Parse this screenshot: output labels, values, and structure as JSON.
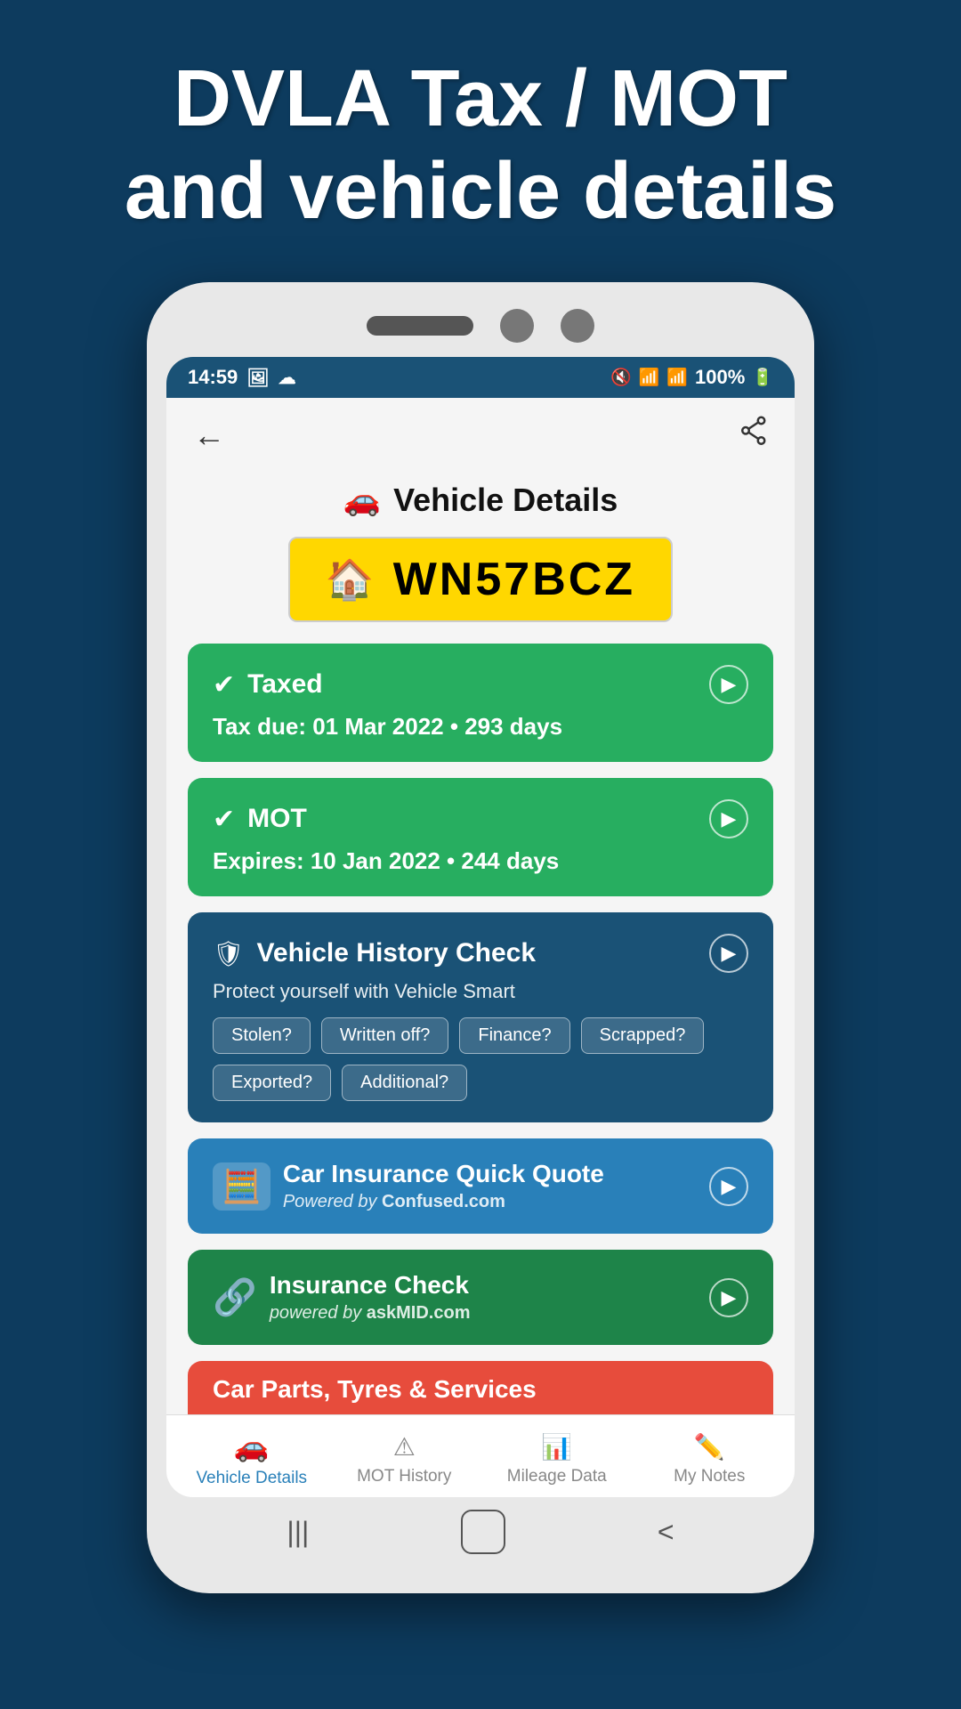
{
  "header": {
    "title_line1": "DVLA Tax / MOT",
    "title_line2": "and vehicle details"
  },
  "status_bar": {
    "time": "14:59",
    "battery": "100%",
    "signal": "WiFi"
  },
  "app_bar": {
    "back_label": "←",
    "share_label": "⋮"
  },
  "page_title": "Vehicle Details",
  "plate": {
    "reg": "WN57BCZ"
  },
  "cards": {
    "taxed": {
      "title": "Taxed",
      "detail": "Tax due: 01 Mar 2022 • 293 days"
    },
    "mot": {
      "title": "MOT",
      "detail": "Expires: 10 Jan 2022 • 244 days"
    },
    "history_check": {
      "title": "Vehicle History Check",
      "desc": "Protect yourself with Vehicle Smart",
      "tags": [
        "Stolen?",
        "Written off?",
        "Finance?",
        "Scrapped?",
        "Exported?",
        "Additional?"
      ]
    },
    "insurance_quote": {
      "title": "Car Insurance Quick Quote",
      "powered_by": "Powered by",
      "brand": "Confused.com"
    },
    "insurance_check": {
      "title": "Insurance Check",
      "powered_by": "powered by",
      "brand": "askMID.com"
    },
    "car_parts": {
      "title": "Car Parts, Tyres & Services"
    }
  },
  "bottom_nav": {
    "items": [
      {
        "label": "Vehicle Details",
        "icon": "🚗",
        "active": true
      },
      {
        "label": "MOT History",
        "icon": "⚠",
        "active": false
      },
      {
        "label": "Mileage Data",
        "icon": "📊",
        "active": false
      },
      {
        "label": "My Notes",
        "icon": "✏️",
        "active": false
      }
    ]
  }
}
